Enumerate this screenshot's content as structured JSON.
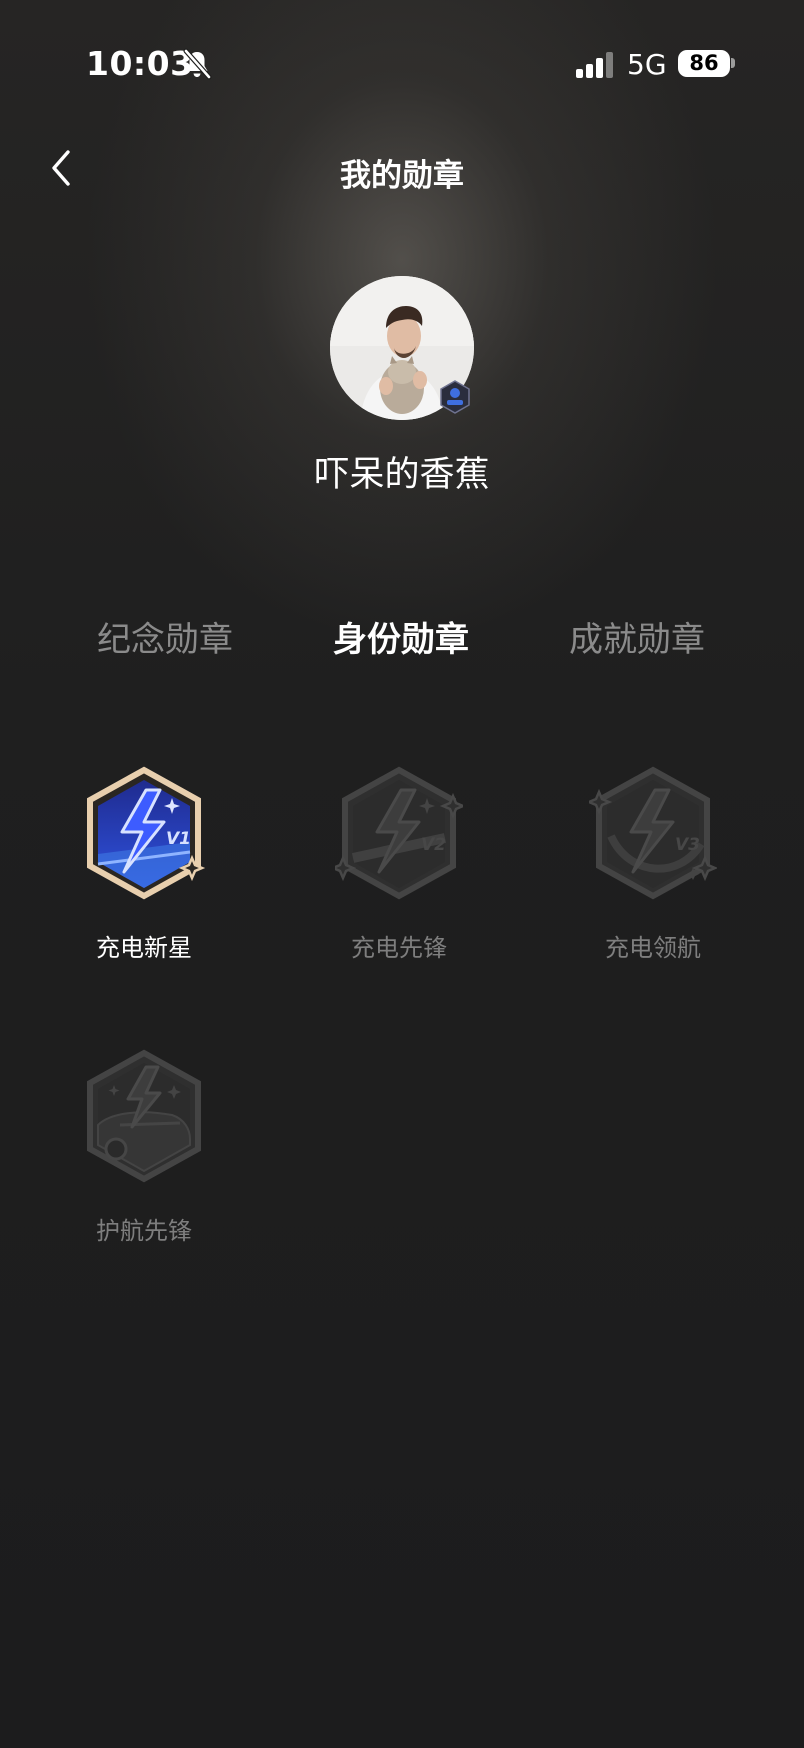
{
  "status_bar": {
    "time": "10:03",
    "network": "5G",
    "battery": "86"
  },
  "header": {
    "title": "我的勋章"
  },
  "profile": {
    "name": "吓呆的香蕉"
  },
  "tabs": [
    {
      "label": "纪念勋章",
      "active": false
    },
    {
      "label": "身份勋章",
      "active": true
    },
    {
      "label": "成就勋章",
      "active": false
    }
  ],
  "badges": [
    {
      "label": "充电新星",
      "level": "V1",
      "earned": true,
      "icon": "lightning-badge-icon"
    },
    {
      "label": "充电先锋",
      "level": "V2",
      "earned": false,
      "icon": "lightning-badge-icon"
    },
    {
      "label": "充电领航",
      "level": "V3",
      "earned": false,
      "icon": "lightning-badge-icon"
    },
    {
      "label": "护航先锋",
      "level": "",
      "earned": false,
      "icon": "car-lightning-badge-icon"
    }
  ],
  "colors": {
    "background": "#1c1c1d",
    "tab_inactive": "#8b8b8b",
    "badge_earned_blue": "#2f49d6",
    "badge_earned_border": "#e6c8a6",
    "badge_locked": "#3a3a3a"
  }
}
